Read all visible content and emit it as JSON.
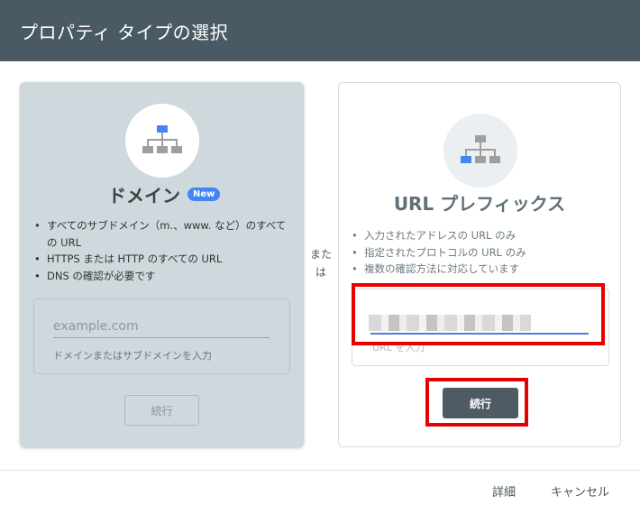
{
  "dialog": {
    "title": "プロパティ タイプの選択"
  },
  "domain_card": {
    "icon": "sitemap-icon",
    "title": "ドメイン",
    "badge": "New",
    "features": [
      "すべてのサブドメイン（m.、www. など）のすべての URL",
      "HTTPS または HTTP のすべての URL",
      "DNS の確認が必要です"
    ],
    "input": {
      "placeholder": "example.com",
      "help": "ドメインまたはサブドメインを入力"
    },
    "continue_label": "続行"
  },
  "separator": {
    "text_line1": "また",
    "text_line2": "は"
  },
  "url_card": {
    "icon": "sitemap-icon",
    "title": "URL プレフィックス",
    "features": [
      "入力されたアドレスの URL のみ",
      "指定されたプロトコルの URL のみ",
      "複数の確認方法に対応しています"
    ],
    "input": {
      "help": "URL を入力"
    },
    "continue_label": "続行"
  },
  "footer": {
    "detail_label": "詳細",
    "cancel_label": "キャンセル"
  },
  "colors": {
    "header_bg": "#4a5a64",
    "selected_card_bg": "#cfd8dc",
    "primary_button": "#4e5b62",
    "badge": "#4285f4",
    "highlight": "#e60000"
  }
}
